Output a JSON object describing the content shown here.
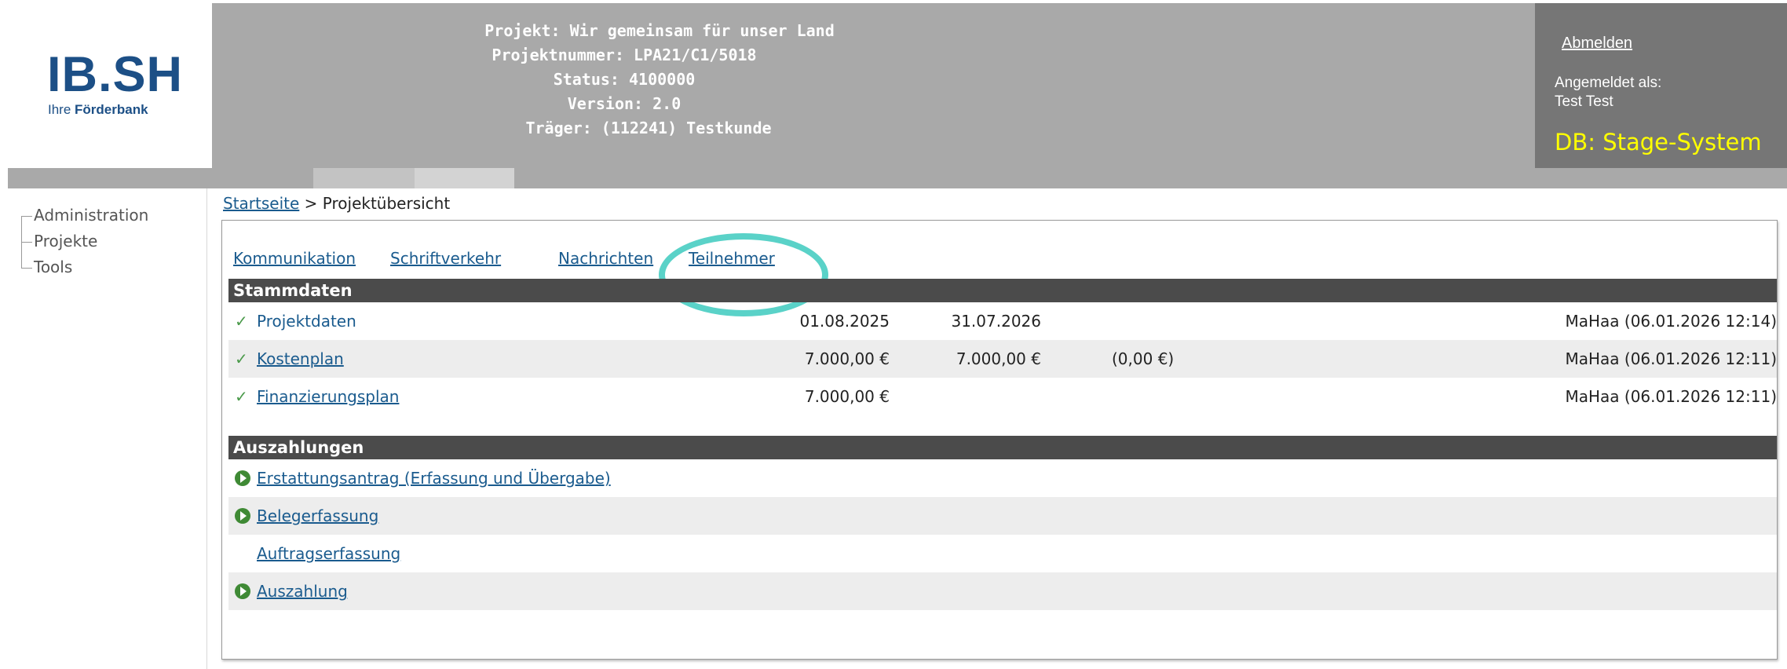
{
  "logo": {
    "main": "IB.SH",
    "main_left": "IB",
    "main_right": "SH",
    "sub_prefix": "Ihre ",
    "sub_bold": "Förderbank"
  },
  "header": {
    "lines": [
      "Projekt: Wir gemeinsam für unser Land",
      "Projektnummer: LPA21/C1/5018",
      "Status: 4100000",
      "Version: 2.0",
      "Träger: (112241) Testkunde"
    ]
  },
  "user": {
    "logout": "Abmelden",
    "logged_in_label": "Angemeldet als:",
    "user_name": "Test Test",
    "db_label": "DB: Stage-System"
  },
  "sidebar": {
    "items": [
      {
        "label": "Administration"
      },
      {
        "label": "Projekte"
      },
      {
        "label": "Tools"
      }
    ]
  },
  "breadcrumb": {
    "home": "Startseite",
    "separator": " > ",
    "current": "Projektübersicht"
  },
  "nav_links": [
    "Kommunikation",
    "Schriftverkehr",
    "Nachrichten",
    "Teilnehmer"
  ],
  "sections": {
    "stammdaten": {
      "title": "Stammdaten",
      "rows": [
        {
          "label": "Projektdaten",
          "c1": "01.08.2025",
          "c2": "31.07.2026",
          "c3": "",
          "c4": "MaHaa (06.01.2026 12:14)"
        },
        {
          "label": "Kostenplan",
          "c1": "7.000,00 €",
          "c2": "7.000,00 €",
          "c3": "(0,00 €)",
          "c4": "MaHaa (06.01.2026 12:11)"
        },
        {
          "label": "Finanzierungsplan",
          "c1": "7.000,00 €",
          "c2": "",
          "c3": "",
          "c4": "MaHaa (06.01.2026 12:11)"
        }
      ]
    },
    "auszahlungen": {
      "title": "Auszahlungen",
      "rows": [
        {
          "label": "Erstattungsantrag (Erfassung und Übergabe)"
        },
        {
          "label": "Belegerfassung"
        },
        {
          "label": "Auftragserfassung"
        },
        {
          "label": "Auszahlung"
        }
      ]
    }
  },
  "colors": {
    "header_bg": "#a9a9a9",
    "user_box_bg": "#767676",
    "db_label": "#ffff00",
    "link": "#1a5b8e",
    "section_head": "#4b4b4b",
    "highlight_ring": "#5ad2c8",
    "check": "#4a9a4a",
    "go_icon": "#3f8a35"
  },
  "icons": {
    "stammdaten_row": "checkmark-icon",
    "auszahlungen_row": "play-circle-icon"
  }
}
